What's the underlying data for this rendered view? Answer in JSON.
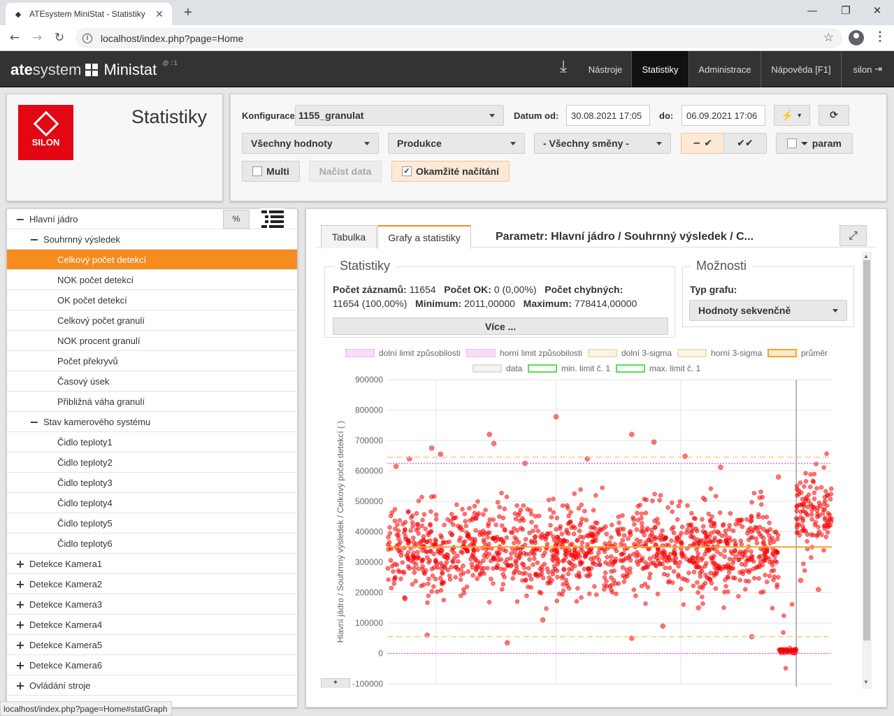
{
  "browser": {
    "tab_title": "ATEsystem MiniStat - Statistiky",
    "url": "localhost/index.php?page=Home",
    "status_url": "localhost/index.php?page=Home#statGraph"
  },
  "header": {
    "logo_bold": "ate",
    "logo_thin": "system",
    "product": "Ministat",
    "superscript": "@ ::1",
    "nav": [
      "Nástroje",
      "Statistiky",
      "Administrace",
      "Nápověda [F1]",
      "silon"
    ]
  },
  "page_title": "Statistiky",
  "brand_logo_text": "SILON",
  "toolbar": {
    "config_label": "Konfigurace:",
    "config_value": "1155_granulat",
    "date_from_label": "Datum od:",
    "date_from": "30.08.2021 17:05",
    "date_to_label": "do:",
    "date_to": "06.09.2021 17:06",
    "values_select": "Všechny hodnoty",
    "production_select": "Produkce",
    "shifts_select": "- Všechny směny -",
    "param_label": "param",
    "multi_label": "Multi",
    "load_label": "Načíst data",
    "instant_label": "Okamžité načítání",
    "colors": {
      "accent": "#f68b1f",
      "brand_red": "#e30613"
    }
  },
  "tree": {
    "percent_button": "%",
    "items": [
      {
        "label": "Hlavní jádro",
        "level": 0,
        "sign": "−"
      },
      {
        "label": "Souhrnný výsledek",
        "level": 1,
        "sign": "−"
      },
      {
        "label": "Celkový počet detekcí",
        "level": 2,
        "sign": "",
        "selected": true
      },
      {
        "label": "NOK počet detekcí",
        "level": 2,
        "sign": ""
      },
      {
        "label": "OK počet detekcí",
        "level": 2,
        "sign": ""
      },
      {
        "label": "Celkový počet granulí",
        "level": 2,
        "sign": ""
      },
      {
        "label": "NOK procent granulí",
        "level": 2,
        "sign": ""
      },
      {
        "label": "Počet překryvů",
        "level": 2,
        "sign": ""
      },
      {
        "label": "Časový úsek",
        "level": 2,
        "sign": ""
      },
      {
        "label": "Přibližná váha granulí",
        "level": 2,
        "sign": ""
      },
      {
        "label": "Stav kamerového systému",
        "level": 1,
        "sign": "−"
      },
      {
        "label": "Čidlo teploty1",
        "level": 2,
        "sign": ""
      },
      {
        "label": "Čidlo teploty2",
        "level": 2,
        "sign": ""
      },
      {
        "label": "Čidlo teploty3",
        "level": 2,
        "sign": ""
      },
      {
        "label": "Čidlo teploty4",
        "level": 2,
        "sign": ""
      },
      {
        "label": "Čidlo teploty5",
        "level": 2,
        "sign": ""
      },
      {
        "label": "Čidlo teploty6",
        "level": 2,
        "sign": ""
      },
      {
        "label": "Detekce Kamera1",
        "level": 0,
        "sign": "+"
      },
      {
        "label": "Detekce Kamera2",
        "level": 0,
        "sign": "+"
      },
      {
        "label": "Detekce Kamera3",
        "level": 0,
        "sign": "+"
      },
      {
        "label": "Detekce Kamera4",
        "level": 0,
        "sign": "+"
      },
      {
        "label": "Detekce Kamera5",
        "level": 0,
        "sign": "+"
      },
      {
        "label": "Detekce Kamera6",
        "level": 0,
        "sign": "+"
      },
      {
        "label": "Ovládání stroje",
        "level": 0,
        "sign": "+"
      }
    ]
  },
  "main": {
    "tabs": [
      "Tabulka",
      "Grafy a statistiky"
    ],
    "param_title": "Parametr: Hlavní jádro / Souhrnný výsledek / C...",
    "stats_title": "Statistiky",
    "options_title": "Možnosti",
    "stats": {
      "records_label": "Počet záznamů:",
      "records": "11654",
      "ok_label": "Počet OK:",
      "ok": "0 (0,00%)",
      "err_label": "Počet chybných:",
      "err": "11654 (100,00%)",
      "min_label": "Minimum:",
      "min": "2011,00000",
      "max_label": "Maximum:",
      "max": "778414,00000"
    },
    "more_button": "Více ...",
    "graph_type_label": "Typ grafu:",
    "graph_type_value": "Hodnoty sekvenčně"
  },
  "chart_data": {
    "type": "scatter",
    "ylabel": "Hlavní jádro / Souhrnný výsledek / Celkový počet detekcí ( )",
    "ylim": [
      -100000,
      900000
    ],
    "yticks": [
      "900000",
      "800000",
      "700000",
      "600000",
      "500000",
      "400000",
      "300000",
      "200000",
      "100000",
      "0",
      "-100000"
    ],
    "n_points": 11654,
    "legend": [
      {
        "name": "dolní limit způsobilosti",
        "color": "#e39be6"
      },
      {
        "name": "horní limit způsobilosti",
        "color": "#e39be6"
      },
      {
        "name": "dolní 3-sigma",
        "color": "#f3dfb8"
      },
      {
        "name": "horní 3-sigma",
        "color": "#f3dfb8"
      },
      {
        "name": "průměr",
        "color": "#f5a623"
      },
      {
        "name": "data",
        "color": "#dddddd"
      },
      {
        "name": "min. limit č. 1",
        "color": "#55e055"
      },
      {
        "name": "max. limit č. 1",
        "color": "#55e055"
      }
    ],
    "lines": {
      "mean": 350000,
      "upper_3sigma": 645000,
      "lower_3sigma": 55000,
      "upper_capability": 625000,
      "lower_capability": 0
    },
    "segments": [
      {
        "from": 0,
        "to": 0.1,
        "center": 345000,
        "spread": 70000
      },
      {
        "from": 0.1,
        "to": 0.15,
        "center": 330000,
        "spread": 60000
      },
      {
        "from": 0.15,
        "to": 0.42,
        "center": 345000,
        "spread": 70000
      },
      {
        "from": 0.42,
        "to": 0.74,
        "center": 350000,
        "spread": 70000
      },
      {
        "from": 0.74,
        "to": 0.88,
        "center": 340000,
        "spread": 65000
      },
      {
        "from": 0.88,
        "to": 0.92,
        "center": 8000,
        "spread": 4000
      },
      {
        "from": 0.92,
        "to": 1.0,
        "center": 460000,
        "spread": 55000
      }
    ],
    "outliers": [
      {
        "x": 0.02,
        "y": 615000
      },
      {
        "x": 0.05,
        "y": 640000
      },
      {
        "x": 0.1,
        "y": 675000
      },
      {
        "x": 0.12,
        "y": 655000
      },
      {
        "x": 0.23,
        "y": 720000
      },
      {
        "x": 0.24,
        "y": 690000
      },
      {
        "x": 0.31,
        "y": 625000
      },
      {
        "x": 0.38,
        "y": 778000
      },
      {
        "x": 0.45,
        "y": 640000
      },
      {
        "x": 0.55,
        "y": 720000
      },
      {
        "x": 0.6,
        "y": 695000
      },
      {
        "x": 0.67,
        "y": 648000
      },
      {
        "x": 0.75,
        "y": 612000
      },
      {
        "x": 0.88,
        "y": 580000
      },
      {
        "x": 0.04,
        "y": 180000
      },
      {
        "x": 0.09,
        "y": 60000
      },
      {
        "x": 0.27,
        "y": 35000
      },
      {
        "x": 0.55,
        "y": 50000
      },
      {
        "x": 0.82,
        "y": 55000
      },
      {
        "x": 0.35,
        "y": 110000
      },
      {
        "x": 0.62,
        "y": 90000
      },
      {
        "x": 0.7,
        "y": 150000
      },
      {
        "x": 0.93,
        "y": 240000
      },
      {
        "x": 0.97,
        "y": 210000
      }
    ]
  }
}
